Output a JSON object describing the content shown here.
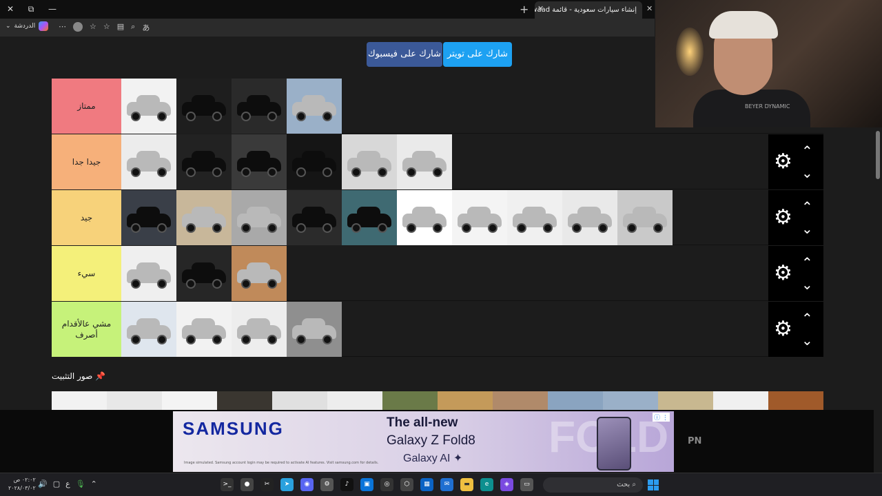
{
  "browser": {
    "tab_title": "إنشاء سيارات سعودية - قائمة Awaad",
    "copilot_label": "الدردشة",
    "new_tab_icon": "plus-icon",
    "close_icon": "close-icon"
  },
  "share": {
    "facebook_label": "شارك على فيسبوك",
    "twitter_label": "شارك على تويتر"
  },
  "tiers": [
    {
      "label": "ممتاز",
      "color": "#f07a80",
      "items": [
        "#f2f2f2",
        "#1e1e1e",
        "#2a2a2a",
        "#9ab0c8"
      ]
    },
    {
      "label": "جيدا جدا",
      "color": "#f6b07a",
      "items": [
        "#ececec",
        "#222222",
        "#3a3a3a",
        "#151515",
        "#d8d8d8",
        "#eaeaea"
      ]
    },
    {
      "label": "جيد",
      "color": "#f7d27a",
      "items": [
        "#3a3f48",
        "#c8b79a",
        "#a9a9a9",
        "#2b2b2b",
        "#3f6a72",
        "#ffffff",
        "#f4f4f4",
        "#f0f0f0",
        "#e9e9e9",
        "#c9c9c9"
      ]
    },
    {
      "label": "سيء",
      "color": "#f4f07a",
      "items": [
        "#efefef",
        "#262626",
        "#c08a5a"
      ]
    },
    {
      "label": "مشي عالأقدام\nأصرف",
      "color": "#c6f27a",
      "items": [
        "#dfe6ee",
        "#f2f2f2",
        "#ededed",
        "#8f8f8f"
      ]
    }
  ],
  "pinned": {
    "title": "صور التثبيت",
    "pin_icon": "pin-icon",
    "thumbs": [
      "#f2f2f2",
      "#e8e8e8",
      "#f4f4f4",
      "#3a3630",
      "#e0e0e0",
      "#ededed",
      "#6a7a48",
      "#c49a5a",
      "#b08a6a",
      "#8aa4c0",
      "#9ab0c8",
      "#c8b890",
      "#f0f0f0",
      "#a05a2a"
    ]
  },
  "ad": {
    "brand": "SAMSUNG",
    "headline": "The all-new",
    "product": "Galaxy Z Fold8",
    "ai": "Galaxy AI ✦",
    "fine_print": "Image simulated. Samsung account login may be required to activate AI features. Visit samsung.com for details.",
    "watermark": "FOLD",
    "side_text": "PN"
  },
  "webcam": {
    "shirt_text": "BEYER DYNAMIC"
  },
  "taskbar": {
    "time": "٠٢:٠٢ ص",
    "date": "٢٠٢٨/٠٣/٠٢",
    "lang": "ع",
    "search_placeholder": "بحث"
  }
}
